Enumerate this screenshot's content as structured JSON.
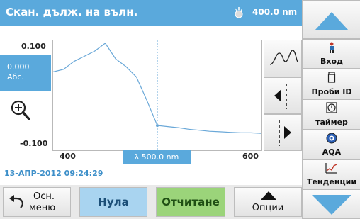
{
  "header": {
    "title": "Скан. дълж. на вълн.",
    "wavelength": "400.0 nm"
  },
  "graph": {
    "y_max": "0.100",
    "y_min": "-0.100",
    "y_current_value": "0.000",
    "y_unit": "Абс.",
    "x_min": "400",
    "x_max": "600",
    "cursor_readout": "λ 500.0 nm"
  },
  "chart_data": {
    "type": "line",
    "xlim": [
      400,
      600
    ],
    "ylim": [
      -0.1,
      0.1
    ],
    "x": [
      400,
      410,
      420,
      430,
      440,
      450,
      460,
      470,
      480,
      490,
      500,
      510,
      520,
      530,
      540,
      550,
      560,
      570,
      580,
      590,
      600
    ],
    "y": [
      0.045,
      0.05,
      0.065,
      0.075,
      0.085,
      0.1,
      0.07,
      0.055,
      0.035,
      -0.01,
      -0.058,
      -0.06,
      -0.062,
      -0.065,
      -0.067,
      -0.069,
      -0.07,
      -0.071,
      -0.072,
      -0.072,
      -0.073
    ],
    "cursor_x": 500,
    "line_color": "#6aa8d8",
    "grid": false
  },
  "datetime": "13-АПР-2012  09:24:29",
  "bottom": {
    "home_label_line1": "Осн.",
    "home_label_line2": "меню",
    "zero_label": "Нула",
    "read_label": "Отчитане",
    "options_label": "Опции"
  },
  "sidebar": {
    "items": [
      {
        "label": "Вход",
        "icon": "person-icon"
      },
      {
        "label": "Проби ID",
        "icon": "sample-bottle-icon"
      },
      {
        "label": "таймер",
        "icon": "timer-icon"
      },
      {
        "label": "AQA",
        "icon": "aqa-icon"
      },
      {
        "label": "Тенденции",
        "icon": "trend-chart-icon"
      }
    ]
  },
  "colors": {
    "accent": "#5aa9dc",
    "read_button": "#9bd47a",
    "zero_button": "#a9d4f0"
  }
}
